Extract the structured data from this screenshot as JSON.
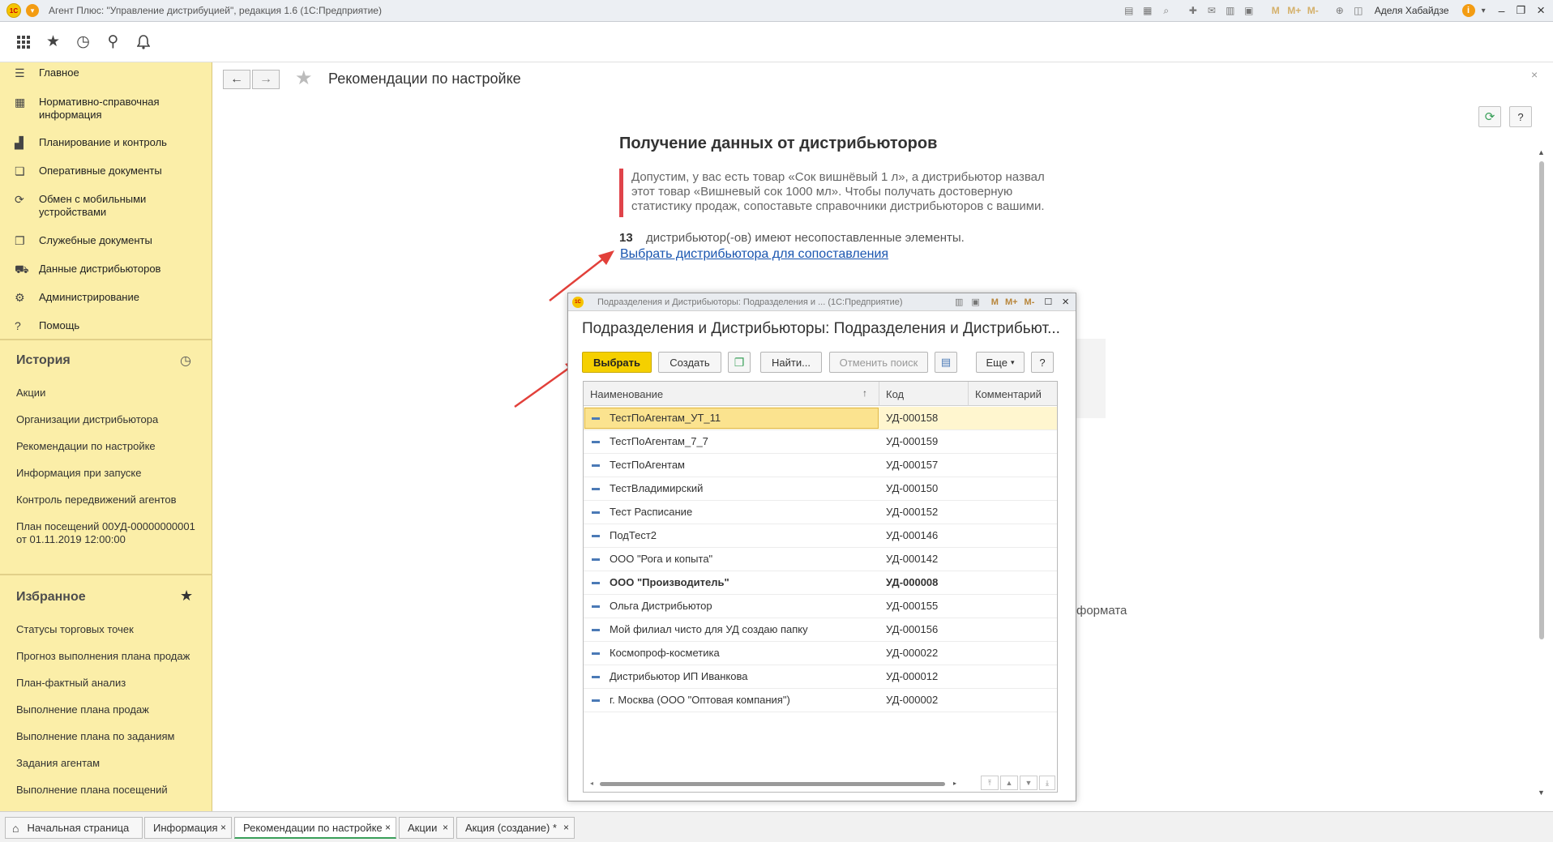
{
  "window": {
    "title": "Агент Плюс: \"Управление дистрибуцией\", редакция 1.6  (1С:Предприятие)",
    "user": "Аделя Хабайдзе",
    "tool_icons": [
      "save-icon",
      "print-icon",
      "preview-icon",
      "attach-icon",
      "mail-icon",
      "table-icon",
      "calendar-icon",
      "m-icon",
      "mplus-icon",
      "mminus-icon",
      "zoom-icon",
      "panel-icon"
    ]
  },
  "top_toolbar": {
    "icons": [
      "apps-grid-icon",
      "star-icon",
      "history-icon",
      "search-icon",
      "bell-icon"
    ]
  },
  "sidebar": {
    "nav": [
      {
        "label": "Главное",
        "icon": "menu-lines-icon"
      },
      {
        "label": "Нормативно-справочная информация",
        "icon": "catalog-icon"
      },
      {
        "label": "Планирование и контроль",
        "icon": "chart-icon"
      },
      {
        "label": "Оперативные документы",
        "icon": "documents-icon"
      },
      {
        "label": "Обмен с мобильными устройствами",
        "icon": "sync-icon"
      },
      {
        "label": "Служебные документы",
        "icon": "service-docs-icon"
      },
      {
        "label": "Данные дистрибьюторов",
        "icon": "distributor-data-icon"
      },
      {
        "label": "Администрирование",
        "icon": "gear-icon"
      },
      {
        "label": "Помощь",
        "icon": "help-icon"
      }
    ],
    "history_title": "История",
    "history": [
      "Акции",
      "Организации дистрибьютора",
      "Рекомендации по настройке",
      "Информация при запуске",
      "Контроль передвижений агентов",
      "План посещений 00УД-00000000001 от 01.11.2019 12:00:00"
    ],
    "favorites_title": "Избранное",
    "favorites": [
      "Статусы торговых точек",
      "Прогноз выполнения плана продаж",
      "План-фактный анализ",
      "Выполнение плана продаж",
      "Выполнение плана по заданиям",
      "Задания агентам",
      "Выполнение плана посещений"
    ]
  },
  "page": {
    "title": "Рекомендации по настройке",
    "section_title": "Получение данных от дистрибьюторов",
    "quote": "Допустим, у вас есть товар «Сок вишнёвый 1 л», а дистрибьютор назвал этот товар «Вишневый сок 1000 мл». Чтобы получать достоверную статистику продаж, сопоставьте справочники дистрибьюторов с вашими.",
    "count": "13",
    "count_text": "дистрибьютор(-ов) имеют несопоставленные элементы.",
    "link": "Выбрать дистрибьютора для сопоставления",
    "partial_text": "формата",
    "help_label": "?"
  },
  "modal": {
    "window_title": "Подразделения и Дистрибьюторы: Подразделения и ...  (1С:Предприятие)",
    "heading": "Подразделения и Дистрибьюторы: Подразделения и Дистрибьют...",
    "buttons": {
      "select": "Выбрать",
      "create": "Создать",
      "find": "Найти...",
      "cancel_search": "Отменить поиск",
      "more": "Еще",
      "help": "?"
    },
    "columns": [
      "Наименование",
      "Код",
      "Комментарий"
    ],
    "rows": [
      {
        "name": "ТестПоАгентам_УТ_11",
        "code": "УД-000158",
        "selected": true
      },
      {
        "name": "ТестПоАгентам_7_7",
        "code": "УД-000159"
      },
      {
        "name": "ТестПоАгентам",
        "code": "УД-000157"
      },
      {
        "name": "ТестВладимирский",
        "code": "УД-000150"
      },
      {
        "name": "Тест Расписание",
        "code": "УД-000152"
      },
      {
        "name": "ПодТест2",
        "code": "УД-000146"
      },
      {
        "name": "ООО \"Рога и копыта\"",
        "code": "УД-000142"
      },
      {
        "name": "ООО \"Производитель\"",
        "code": "УД-000008",
        "bold": true
      },
      {
        "name": "Ольга Дистрибьютор",
        "code": "УД-000155"
      },
      {
        "name": "Мой филиал чисто для УД создаю папку",
        "code": "УД-000156"
      },
      {
        "name": "Космопроф-косметика",
        "code": "УД-000022"
      },
      {
        "name": "Дистрибьютор ИП Иванкова",
        "code": "УД-000012"
      },
      {
        "name": "г. Москва  (ООО \"Оптовая компания\")",
        "code": "УД-000002"
      }
    ]
  },
  "tabs": [
    {
      "label": "Начальная страница",
      "icon": "home-icon"
    },
    {
      "label": "Информация"
    },
    {
      "label": "Рекомендации по настройке",
      "active": true
    },
    {
      "label": "Акции"
    },
    {
      "label": "Акция (создание) *"
    }
  ],
  "close_glyph": "×",
  "colors": {
    "sidebar_bg": "#fbeea8",
    "accent_yellow": "#f5d000",
    "link_blue": "#1a56b0",
    "quote_bar": "#e0434a",
    "arrow_red": "#e2403a",
    "selected_row": "#fbe38f",
    "active_tab": "#3aa05a"
  }
}
